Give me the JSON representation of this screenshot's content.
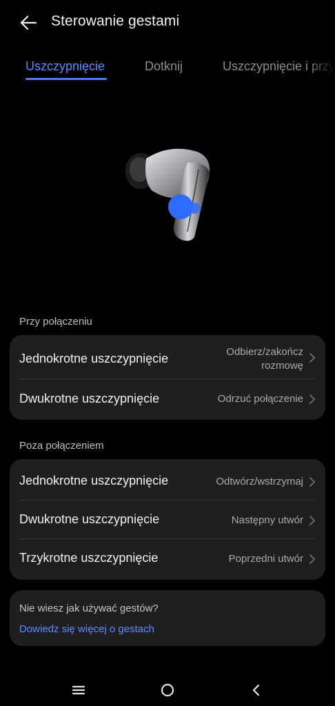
{
  "header": {
    "title": "Sterowanie gestami",
    "back_icon": "arrow-left-icon"
  },
  "tabs": [
    {
      "label": "Uszczypnięcie",
      "active": true
    },
    {
      "label": "Dotknij",
      "active": false
    },
    {
      "label": "Uszczypnięcie i przytrzymaj",
      "active": false
    }
  ],
  "accent_color": "#4c7dff",
  "sections": [
    {
      "label": "Przy połączeniu",
      "rows": [
        {
          "title": "Jednokrotne uszczypnięcie",
          "value_line1": "Odbierz/zakończ",
          "value_line2": "rozmowę"
        },
        {
          "title": "Dwukrotne uszczypnięcie",
          "value": "Odrzuć połączenie"
        }
      ]
    },
    {
      "label": "Poza połączeniem",
      "rows": [
        {
          "title": "Jednokrotne uszczypnięcie",
          "value": "Odtwórz/wstrzymaj"
        },
        {
          "title": "Dwukrotne uszczypnięcie",
          "value": "Następny utwór"
        },
        {
          "title": "Trzykrotne uszczypnięcie",
          "value": "Poprzedni utwór"
        }
      ]
    }
  ],
  "help": {
    "question": "Nie wiesz jak używać gestów?",
    "link": "Dowiedz się więcej o gestach"
  },
  "navbar": {
    "menu_icon": "menu-icon",
    "home_icon": "home-circle-icon",
    "back_icon": "back-triangle-icon"
  }
}
